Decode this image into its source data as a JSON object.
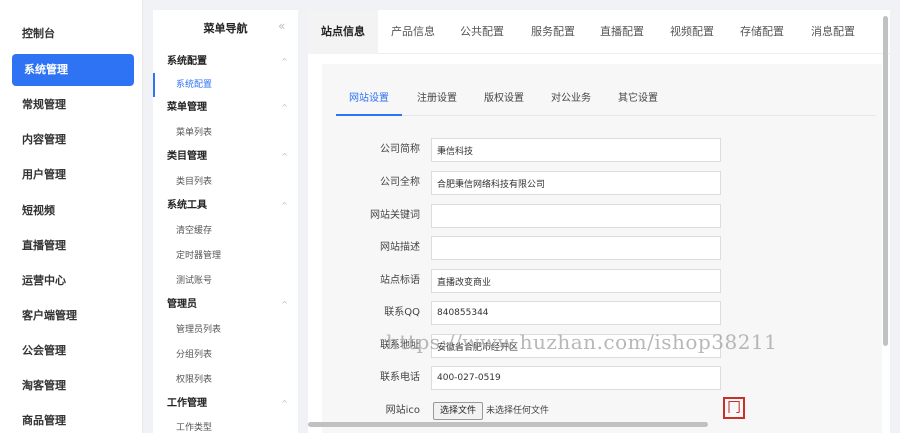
{
  "main_menu": {
    "items": [
      {
        "label": "控制台",
        "active": false
      },
      {
        "label": "系统管理",
        "active": true
      },
      {
        "label": "常规管理",
        "active": false
      },
      {
        "label": "内容管理",
        "active": false
      },
      {
        "label": "用户管理",
        "active": false
      },
      {
        "label": "短视频",
        "active": false
      },
      {
        "label": "直播管理",
        "active": false
      },
      {
        "label": "运营中心",
        "active": false
      },
      {
        "label": "客户端管理",
        "active": false
      },
      {
        "label": "公会管理",
        "active": false
      },
      {
        "label": "淘客管理",
        "active": false
      },
      {
        "label": "商品管理",
        "active": false
      }
    ]
  },
  "subnav": {
    "title": "菜单导航",
    "collapse_icon": "«",
    "groups": [
      {
        "label": "系统配置",
        "items": [
          "系统配置"
        ]
      },
      {
        "label": "菜单管理",
        "items": [
          "菜单列表"
        ]
      },
      {
        "label": "类目管理",
        "items": [
          "类目列表"
        ]
      },
      {
        "label": "系统工具",
        "items": [
          "清空缓存",
          "定时器管理",
          "测试账号"
        ]
      },
      {
        "label": "管理员",
        "items": [
          "管理员列表",
          "分组列表",
          "权限列表"
        ]
      },
      {
        "label": "工作管理",
        "items": [
          "工作类型"
        ]
      }
    ],
    "active_item": "系统配置"
  },
  "top_tabs": [
    "站点信息",
    "产品信息",
    "公共配置",
    "服务配置",
    "直播配置",
    "视频配置",
    "存储配置",
    "消息配置"
  ],
  "inner_tabs": [
    "网站设置",
    "注册设置",
    "版权设置",
    "对公业务",
    "其它设置"
  ],
  "form": {
    "company_short": {
      "label": "公司简称",
      "value": "秉信科技"
    },
    "company_full": {
      "label": "公司全称",
      "value": "合肥秉信网络科技有限公司"
    },
    "keywords": {
      "label": "网站关键词",
      "value": ""
    },
    "description": {
      "label": "网站描述",
      "value": ""
    },
    "slogan": {
      "label": "站点标语",
      "value": "直播改变商业"
    },
    "qq": {
      "label": "联系QQ",
      "value": "840855344"
    },
    "address": {
      "label": "联系地址",
      "value": "安徽省合肥市经开区"
    },
    "phone": {
      "label": "联系电话",
      "value": "400-027-0519"
    },
    "favicon": {
      "label": "网站ico",
      "button": "选择文件",
      "file_text": "未选择任何文件",
      "preview_icon": "stamp-icon"
    }
  },
  "watermark": "https://www.huzhan.com/ishop38211",
  "colors": {
    "accent": "#2f73f5",
    "stamp": "#c9302c"
  }
}
